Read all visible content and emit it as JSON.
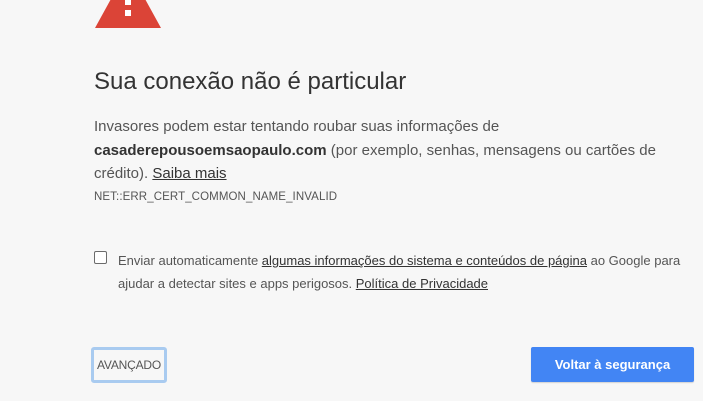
{
  "icon": "warning-triangle-icon",
  "title": "Sua conexão não é particular",
  "description": {
    "intro": "Invasores podem estar tentando roubar suas informações de ",
    "domain": "casaderepousoemsaopaulo.com",
    "details": " (por exemplo, senhas, mensagens ou cartões de crédito). ",
    "learn_more_link": "Saiba mais"
  },
  "error_code": "NET::ERR_CERT_COMMON_NAME_INVALID",
  "optin": {
    "checked": false,
    "text_before": "Enviar automaticamente ",
    "link": "algumas informações do sistema e conteúdos de página",
    "text_middle": " ao Google para ajudar a detectar sites e apps perigosos. ",
    "privacy_link": "Política de Privacidade"
  },
  "buttons": {
    "advanced_label": "AVANÇADO",
    "back_to_safety_label": "Voltar à segurança"
  },
  "colors": {
    "background": "#f7f7f7",
    "warning_red": "#db4437",
    "primary_button": "#4285f4",
    "focus_ring": "#a9cbf0"
  }
}
